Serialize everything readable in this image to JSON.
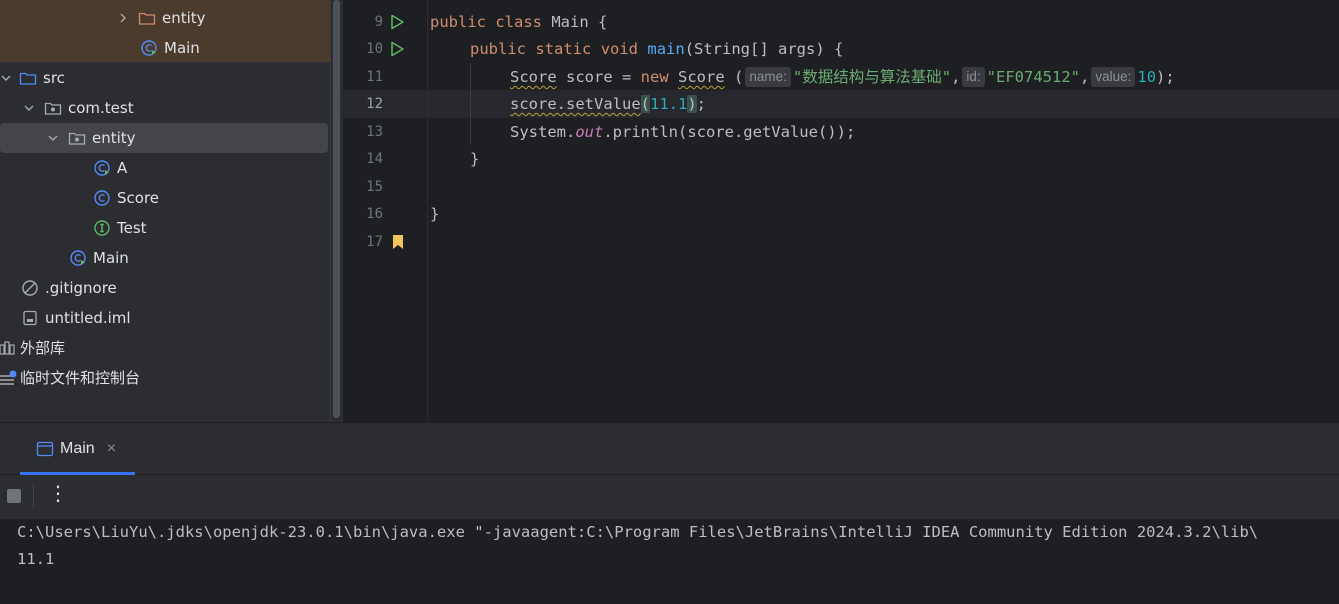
{
  "project_tree": {
    "items": [
      {
        "label": "entity",
        "kind": "folder",
        "icon": "folder-icon"
      },
      {
        "label": "Main",
        "kind": "class-main",
        "icon": "class-run-icon"
      },
      {
        "label": "src",
        "kind": "source-folder",
        "icon": "folder-icon"
      },
      {
        "label": "com.test",
        "kind": "package",
        "icon": "package-icon"
      },
      {
        "label": "entity",
        "kind": "package",
        "icon": "package-icon"
      },
      {
        "label": "A",
        "kind": "class",
        "icon": "class-run-icon"
      },
      {
        "label": "Score",
        "kind": "class",
        "icon": "class-icon"
      },
      {
        "label": "Test",
        "kind": "interface",
        "icon": "interface-icon"
      },
      {
        "label": "Main",
        "kind": "class-main",
        "icon": "class-run-icon"
      },
      {
        "label": ".gitignore",
        "kind": "file",
        "icon": "ignore-file-icon"
      },
      {
        "label": "untitled.iml",
        "kind": "file",
        "icon": "module-file-icon"
      },
      {
        "label": "外部库",
        "kind": "library",
        "icon": "library-icon"
      },
      {
        "label": "临时文件和控制台",
        "kind": "scratch",
        "icon": "scratch-icon"
      }
    ]
  },
  "editor": {
    "line_numbers": [
      "9",
      "10",
      "11",
      "12",
      "13",
      "14",
      "15",
      "16",
      "17"
    ],
    "current_line": "12",
    "code": {
      "l9_kw1": "public",
      "l9_kw2": "class",
      "l9_rest": " Main {",
      "l10_kw1": "public",
      "l10_kw2": "static",
      "l10_kw3": "void",
      "l10_fn": "main",
      "l10_rest": "(String[] args) {",
      "l11_type1": "Score",
      "l11_mid": " score = ",
      "l11_new": "new",
      "l11_type2": "Score",
      "l11_paren": " (",
      "l11_hint1": "name:",
      "l11_str1": "\"数据结构与算法基础\"",
      "l11_comma1": ",",
      "l11_hint2": "id:",
      "l11_str2": "\"EF074512\"",
      "l11_comma2": ",",
      "l11_hint3": "value:",
      "l11_num": "10",
      "l11_end": ");",
      "l12_call": "score.setValue",
      "l12_open": "(",
      "l12_num": "11.1",
      "l12_close": ")",
      "l12_end": ";",
      "l13_a": "System.",
      "l13_out": "out",
      "l13_b": ".println(score.getValue());",
      "l14": "}",
      "l16": "}"
    }
  },
  "run_panel": {
    "tab_label": "Main",
    "tab_close": "×",
    "more_label": "⋮",
    "console_lines": [
      "C:\\Users\\LiuYu\\.jdks\\openjdk-23.0.1\\bin\\java.exe \"-javaagent:C:\\Program Files\\JetBrains\\IntelliJ IDEA Community Edition 2024.3.2\\lib\\",
      "11.1"
    ]
  },
  "colors": {
    "background": "#1e1f22",
    "panel": "#2b2d30",
    "keyword": "#cf8e6d",
    "function": "#56a8f5",
    "string": "#6aab73",
    "number": "#2aacb8",
    "accent": "#3574f0"
  }
}
